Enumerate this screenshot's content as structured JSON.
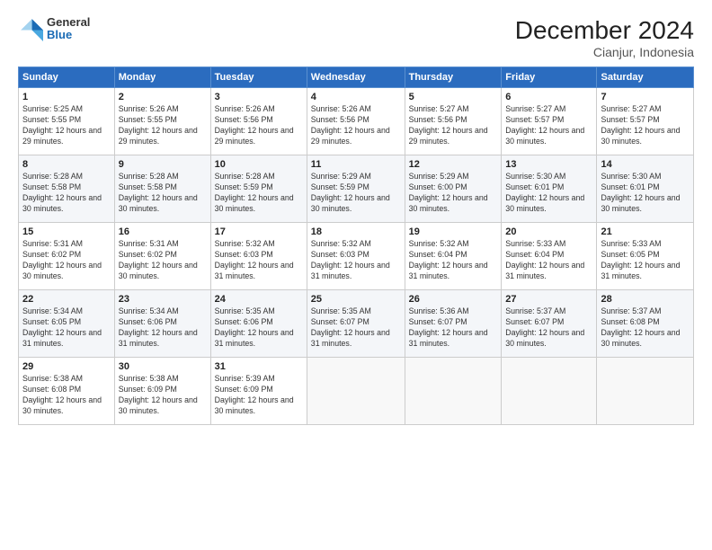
{
  "logo": {
    "general": "General",
    "blue": "Blue"
  },
  "title": "December 2024",
  "subtitle": "Cianjur, Indonesia",
  "days_header": [
    "Sunday",
    "Monday",
    "Tuesday",
    "Wednesday",
    "Thursday",
    "Friday",
    "Saturday"
  ],
  "weeks": [
    [
      {
        "day": "1",
        "sunrise": "5:25 AM",
        "sunset": "5:55 PM",
        "daylight": "12 hours and 29 minutes."
      },
      {
        "day": "2",
        "sunrise": "5:26 AM",
        "sunset": "5:55 PM",
        "daylight": "12 hours and 29 minutes."
      },
      {
        "day": "3",
        "sunrise": "5:26 AM",
        "sunset": "5:56 PM",
        "daylight": "12 hours and 29 minutes."
      },
      {
        "day": "4",
        "sunrise": "5:26 AM",
        "sunset": "5:56 PM",
        "daylight": "12 hours and 29 minutes."
      },
      {
        "day": "5",
        "sunrise": "5:27 AM",
        "sunset": "5:56 PM",
        "daylight": "12 hours and 29 minutes."
      },
      {
        "day": "6",
        "sunrise": "5:27 AM",
        "sunset": "5:57 PM",
        "daylight": "12 hours and 30 minutes."
      },
      {
        "day": "7",
        "sunrise": "5:27 AM",
        "sunset": "5:57 PM",
        "daylight": "12 hours and 30 minutes."
      }
    ],
    [
      {
        "day": "8",
        "sunrise": "5:28 AM",
        "sunset": "5:58 PM",
        "daylight": "12 hours and 30 minutes."
      },
      {
        "day": "9",
        "sunrise": "5:28 AM",
        "sunset": "5:58 PM",
        "daylight": "12 hours and 30 minutes."
      },
      {
        "day": "10",
        "sunrise": "5:28 AM",
        "sunset": "5:59 PM",
        "daylight": "12 hours and 30 minutes."
      },
      {
        "day": "11",
        "sunrise": "5:29 AM",
        "sunset": "5:59 PM",
        "daylight": "12 hours and 30 minutes."
      },
      {
        "day": "12",
        "sunrise": "5:29 AM",
        "sunset": "6:00 PM",
        "daylight": "12 hours and 30 minutes."
      },
      {
        "day": "13",
        "sunrise": "5:30 AM",
        "sunset": "6:01 PM",
        "daylight": "12 hours and 30 minutes."
      },
      {
        "day": "14",
        "sunrise": "5:30 AM",
        "sunset": "6:01 PM",
        "daylight": "12 hours and 30 minutes."
      }
    ],
    [
      {
        "day": "15",
        "sunrise": "5:31 AM",
        "sunset": "6:02 PM",
        "daylight": "12 hours and 30 minutes."
      },
      {
        "day": "16",
        "sunrise": "5:31 AM",
        "sunset": "6:02 PM",
        "daylight": "12 hours and 30 minutes."
      },
      {
        "day": "17",
        "sunrise": "5:32 AM",
        "sunset": "6:03 PM",
        "daylight": "12 hours and 31 minutes."
      },
      {
        "day": "18",
        "sunrise": "5:32 AM",
        "sunset": "6:03 PM",
        "daylight": "12 hours and 31 minutes."
      },
      {
        "day": "19",
        "sunrise": "5:32 AM",
        "sunset": "6:04 PM",
        "daylight": "12 hours and 31 minutes."
      },
      {
        "day": "20",
        "sunrise": "5:33 AM",
        "sunset": "6:04 PM",
        "daylight": "12 hours and 31 minutes."
      },
      {
        "day": "21",
        "sunrise": "5:33 AM",
        "sunset": "6:05 PM",
        "daylight": "12 hours and 31 minutes."
      }
    ],
    [
      {
        "day": "22",
        "sunrise": "5:34 AM",
        "sunset": "6:05 PM",
        "daylight": "12 hours and 31 minutes."
      },
      {
        "day": "23",
        "sunrise": "5:34 AM",
        "sunset": "6:06 PM",
        "daylight": "12 hours and 31 minutes."
      },
      {
        "day": "24",
        "sunrise": "5:35 AM",
        "sunset": "6:06 PM",
        "daylight": "12 hours and 31 minutes."
      },
      {
        "day": "25",
        "sunrise": "5:35 AM",
        "sunset": "6:07 PM",
        "daylight": "12 hours and 31 minutes."
      },
      {
        "day": "26",
        "sunrise": "5:36 AM",
        "sunset": "6:07 PM",
        "daylight": "12 hours and 31 minutes."
      },
      {
        "day": "27",
        "sunrise": "5:37 AM",
        "sunset": "6:07 PM",
        "daylight": "12 hours and 30 minutes."
      },
      {
        "day": "28",
        "sunrise": "5:37 AM",
        "sunset": "6:08 PM",
        "daylight": "12 hours and 30 minutes."
      }
    ],
    [
      {
        "day": "29",
        "sunrise": "5:38 AM",
        "sunset": "6:08 PM",
        "daylight": "12 hours and 30 minutes."
      },
      {
        "day": "30",
        "sunrise": "5:38 AM",
        "sunset": "6:09 PM",
        "daylight": "12 hours and 30 minutes."
      },
      {
        "day": "31",
        "sunrise": "5:39 AM",
        "sunset": "6:09 PM",
        "daylight": "12 hours and 30 minutes."
      },
      null,
      null,
      null,
      null
    ]
  ]
}
